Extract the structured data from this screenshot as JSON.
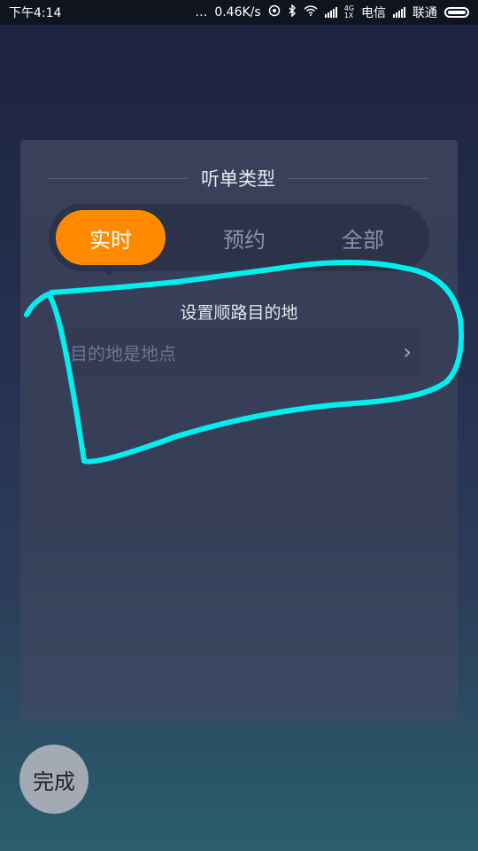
{
  "status_bar": {
    "time": "下午4:14",
    "dots": "…",
    "speed": "0.46K/s",
    "network_4g": "4G",
    "network_1x": "1X",
    "carrier1": "电信",
    "carrier2": "联通",
    "battery_level": 1.0
  },
  "panel": {
    "section_title": "听单类型",
    "tabs": [
      {
        "label": "实时",
        "active": true
      },
      {
        "label": "预约",
        "active": false
      },
      {
        "label": "全部",
        "active": false
      }
    ],
    "destination": {
      "title": "设置顺路目的地",
      "placeholder": "目的地是地点",
      "chevron": "›"
    }
  },
  "done_button": {
    "label": "完成"
  },
  "colors": {
    "accent": "#ff8a00",
    "annotation": "#00f0f0"
  },
  "icons": [
    "hotspot-icon",
    "bluetooth-icon",
    "wifi-icon",
    "signal-icon",
    "battery-icon",
    "chevron-right-icon"
  ]
}
